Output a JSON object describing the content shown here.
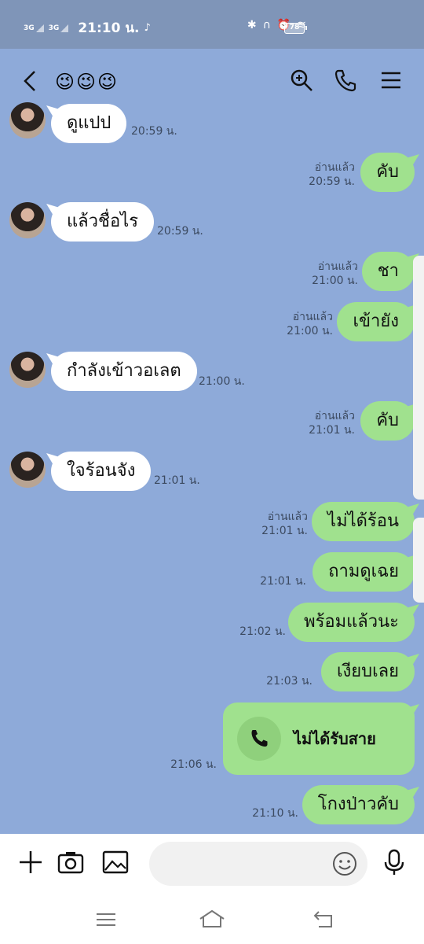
{
  "status_bar": {
    "network_1": "3G",
    "network_2": "3G",
    "time": "21:10 น.",
    "battery": "78"
  },
  "header": {
    "title": "😉😉😉"
  },
  "messages": [
    {
      "dir": "in",
      "text": "ดูแปป",
      "time": "20:59 น."
    },
    {
      "dir": "out",
      "text": "คับ",
      "read": "อ่านแล้ว",
      "time": "20:59 น."
    },
    {
      "dir": "in",
      "text": "แล้วชื่อไร",
      "time": "20:59 น."
    },
    {
      "dir": "out",
      "text": "ชา",
      "read": "อ่านแล้ว",
      "time": "21:00 น."
    },
    {
      "dir": "out",
      "text": "เข้ายัง",
      "read": "อ่านแล้ว",
      "time": "21:00 น."
    },
    {
      "dir": "in",
      "text": "กำลังเข้าวอเลต",
      "time": "21:00 น."
    },
    {
      "dir": "out",
      "text": "คับ",
      "read": "อ่านแล้ว",
      "time": "21:01 น."
    },
    {
      "dir": "in",
      "text": "ใจร้อนจัง",
      "time": "21:01 น."
    },
    {
      "dir": "out",
      "text": "ไม่ได้ร้อน",
      "read": "อ่านแล้ว",
      "time": "21:01 น."
    },
    {
      "dir": "out",
      "text": "ถามดูเฉย",
      "time": "21:01 น."
    },
    {
      "dir": "out",
      "text": "พร้อมแล้วนะ",
      "time": "21:02 น."
    },
    {
      "dir": "out",
      "text": "เงียบเลย",
      "time": "21:03 น."
    },
    {
      "dir": "out",
      "text": "โกงป่าวคับ",
      "time": "21:10 น."
    }
  ],
  "call": {
    "label": "ไม่ได้รับสาย",
    "time": "21:06 น."
  },
  "input": {
    "placeholder": ""
  },
  "colors": {
    "chat_background": "#8eaad9",
    "outgoing_bubble": "#a0e18e",
    "incoming_bubble": "#ffffff"
  }
}
